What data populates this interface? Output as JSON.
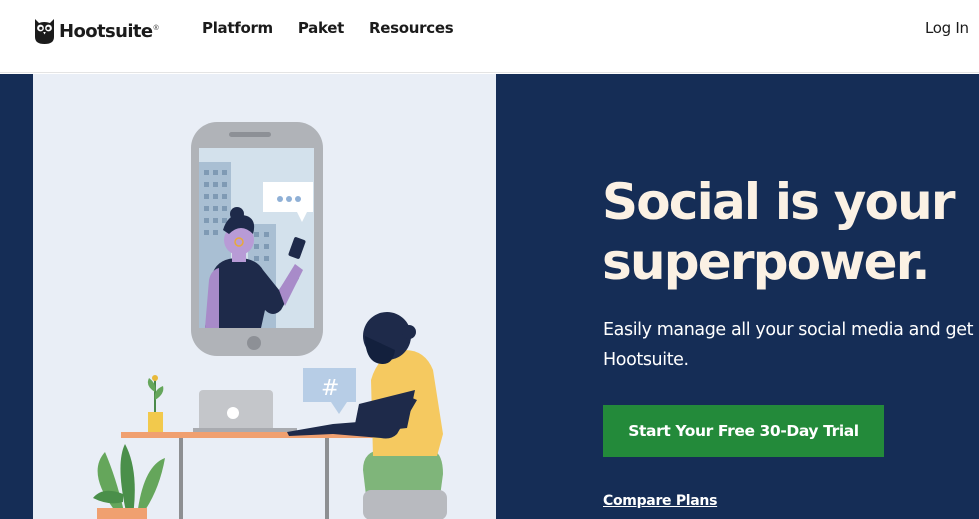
{
  "header": {
    "logo_text": "Hootsuite",
    "logo_mark": "®",
    "nav": [
      {
        "label": "Platform"
      },
      {
        "label": "Paket"
      },
      {
        "label": "Resources"
      }
    ],
    "login_label": "Log In"
  },
  "hero": {
    "headline_line1": "Social is your",
    "headline_line2": "superpower.",
    "subtext_line1": "Easily manage all your social media and get results with",
    "subtext_line2": "Hootsuite.",
    "cta_label": "Start Your Free 30-Day Trial",
    "compare_label": "Compare Plans",
    "illustration": {
      "chat_bubble_text": "•••",
      "hashtag_text": "#"
    }
  },
  "colors": {
    "hero_bg": "#152d56",
    "illustration_bg": "#e9eef6",
    "headline": "#fbf1e4",
    "cta_bg": "#238a3a"
  },
  "icons": [
    "owl-logo-icon",
    "phone-illustration",
    "laptop-illustration",
    "plant-illustration"
  ]
}
